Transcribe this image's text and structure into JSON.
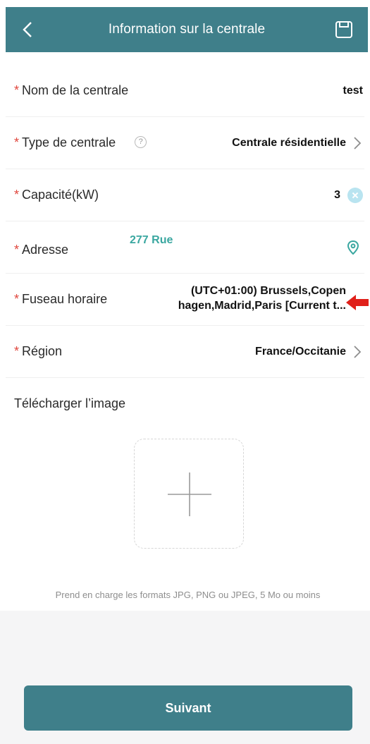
{
  "header": {
    "title": "Information sur la centrale",
    "back_icon": "chevron-left-icon",
    "save_icon": "save-icon",
    "color": "#3f7f8a"
  },
  "form": {
    "required_mark": "*",
    "name": {
      "label": "Nom de la centrale",
      "value": "test"
    },
    "type": {
      "label": "Type de centrale",
      "help_icon": "help-icon",
      "value": "Centrale résidentielle"
    },
    "capacity": {
      "label": "Capacité(kW)",
      "value": "3"
    },
    "address": {
      "label": "Adresse",
      "value": "277 Rue"
    },
    "timezone": {
      "label": "Fuseau horaire",
      "value_line1": "(UTC+01:00) Brussels,Copen",
      "value_line2": "hagen,Madrid,Paris [Current t..."
    },
    "region": {
      "label": "Région",
      "value": "France/Occitanie"
    }
  },
  "upload": {
    "label": "Télécharger l’image",
    "formats_text": "Prend en charge les formats JPG, PNG ou JPEG, 5 Mo ou moins"
  },
  "next_button": {
    "label": "Suivant"
  },
  "colors": {
    "required": "#e0463d",
    "accent": "#3aa7a0",
    "annotation_arrow": "#e0201a"
  }
}
